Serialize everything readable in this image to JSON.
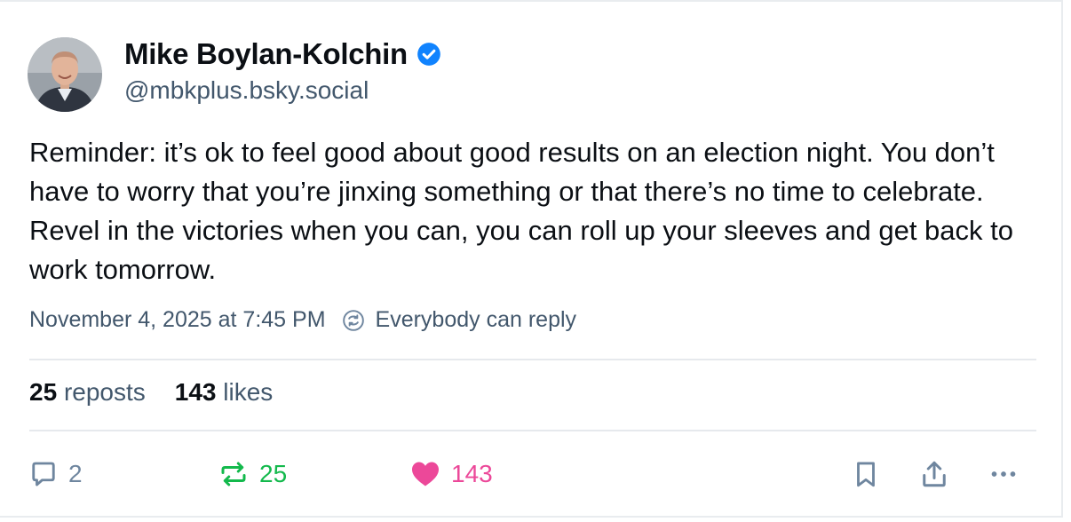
{
  "author": {
    "name": "Mike Boylan-Kolchin",
    "handle": "@mbkplus.bsky.social",
    "verified": true
  },
  "post": {
    "text": "Reminder: it’s ok to feel good about good results on an election night. You don’t have to worry that you’re jinxing something or that there’s no time to celebrate. Revel in the victories when you can, you can roll up your sleeves and get back to work tomorrow.",
    "timestamp": "November 4, 2025 at 7:45 PM",
    "reply_setting": "Everybody can reply"
  },
  "stats": {
    "reposts_count": "25",
    "reposts_label": "reposts",
    "likes_count": "143",
    "likes_label": "likes"
  },
  "actions": {
    "reply_count": "2",
    "repost_count": "25",
    "like_count": "143",
    "icons": [
      "reply-icon",
      "repost-icon",
      "heart-icon",
      "bookmark-icon",
      "share-icon",
      "more-icon"
    ]
  },
  "colors": {
    "verified_blue": "#1083fe",
    "repost_green": "#13b94c",
    "like_pink": "#ec4899",
    "muted_text": "#42576c",
    "icon_gray": "#6f869f"
  }
}
